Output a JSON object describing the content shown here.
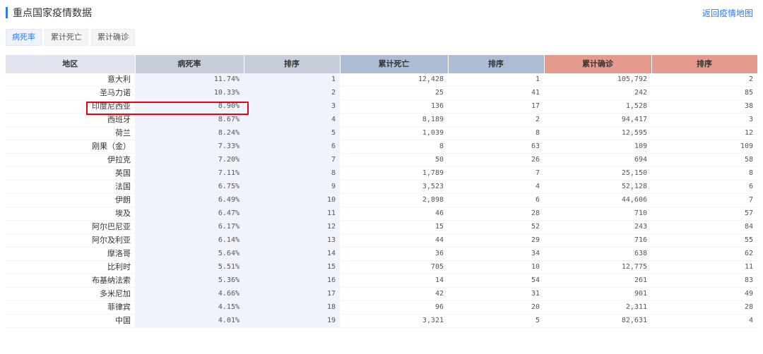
{
  "header": {
    "title": "重点国家疫情数据",
    "back_link": "返回疫情地图"
  },
  "tabs": [
    {
      "label": "病死率",
      "active": true
    },
    {
      "label": "累计死亡",
      "active": false
    },
    {
      "label": "累计确诊",
      "active": false
    }
  ],
  "table": {
    "columns": [
      "地区",
      "病死率",
      "排序",
      "累计死亡",
      "排序",
      "累计确诊",
      "排序"
    ],
    "rows": [
      [
        "意大利",
        "11.74%",
        "1",
        "12,428",
        "1",
        "105,792",
        "2"
      ],
      [
        "圣马力诺",
        "10.33%",
        "2",
        "25",
        "41",
        "242",
        "85"
      ],
      [
        "印度尼西亚",
        "8.90%",
        "3",
        "136",
        "17",
        "1,528",
        "38"
      ],
      [
        "西班牙",
        "8.67%",
        "4",
        "8,189",
        "2",
        "94,417",
        "3"
      ],
      [
        "荷兰",
        "8.24%",
        "5",
        "1,039",
        "8",
        "12,595",
        "12"
      ],
      [
        "刚果（金）",
        "7.33%",
        "6",
        "8",
        "63",
        "109",
        "109"
      ],
      [
        "伊拉克",
        "7.20%",
        "7",
        "50",
        "26",
        "694",
        "58"
      ],
      [
        "英国",
        "7.11%",
        "8",
        "1,789",
        "7",
        "25,150",
        "8"
      ],
      [
        "法国",
        "6.75%",
        "9",
        "3,523",
        "4",
        "52,128",
        "6"
      ],
      [
        "伊朗",
        "6.49%",
        "10",
        "2,898",
        "6",
        "44,606",
        "7"
      ],
      [
        "埃及",
        "6.47%",
        "11",
        "46",
        "28",
        "710",
        "57"
      ],
      [
        "阿尔巴尼亚",
        "6.17%",
        "12",
        "15",
        "52",
        "243",
        "84"
      ],
      [
        "阿尔及利亚",
        "6.14%",
        "13",
        "44",
        "29",
        "716",
        "55"
      ],
      [
        "摩洛哥",
        "5.64%",
        "14",
        "36",
        "34",
        "638",
        "62"
      ],
      [
        "比利时",
        "5.51%",
        "15",
        "705",
        "10",
        "12,775",
        "11"
      ],
      [
        "布基纳法索",
        "5.36%",
        "16",
        "14",
        "54",
        "261",
        "83"
      ],
      [
        "多米尼加",
        "4.66%",
        "17",
        "42",
        "31",
        "901",
        "49"
      ],
      [
        "菲律宾",
        "4.15%",
        "18",
        "96",
        "20",
        "2,311",
        "28"
      ],
      [
        "中国",
        "4.01%",
        "19",
        "3,321",
        "5",
        "82,631",
        "4"
      ]
    ]
  },
  "colors": {
    "accent": "#2f7bed",
    "highlight_border": "#e60012",
    "header_death_rate": "#c7cedb",
    "header_total_deaths": "#aebbd4",
    "header_total_confirmed": "#e49a8c"
  }
}
